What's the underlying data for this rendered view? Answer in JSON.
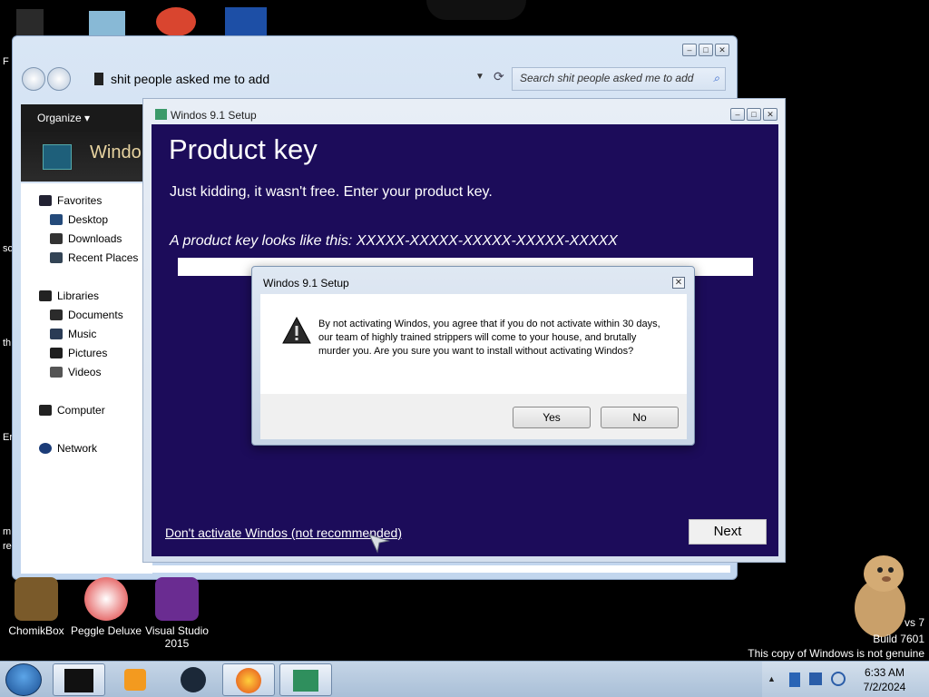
{
  "explorer": {
    "address": "shit people asked me to add",
    "search_placeholder": "Search shit people asked me to add",
    "organize": "Organize ▾",
    "banner_text": "Windo",
    "nav": {
      "favorites": "Favorites",
      "desktop": "Desktop",
      "downloads": "Downloads",
      "recent": "Recent Places",
      "libraries": "Libraries",
      "documents": "Documents",
      "music": "Music",
      "pictures": "Pictures",
      "videos": "Videos",
      "computer": "Computer",
      "network": "Network"
    }
  },
  "setup": {
    "title": "Windos 9.1 Setup",
    "heading": "Product key",
    "subtitle": "Just kidding, it wasn't free. Enter your product key.",
    "example": "A product key looks like this: XXXXX-XXXXX-XXXXX-XXXXX-XXXXX",
    "skip_link": "Don't activate Windos (not recommended)",
    "next": "Next"
  },
  "dialog": {
    "title": "Windos 9.1 Setup",
    "message": "By not activating Windos, you agree that if you do not activate within 30 days, our team of highly trained strippers will come to your house, and brutally murder you. Are you sure you want to install without activating Windos?",
    "yes": "Yes",
    "no": "No",
    "close": "✕"
  },
  "desktop_icons": {
    "chomik": "ChomikBox",
    "peggle": "Peggle Deluxe",
    "vs": "Visual Studio 2015"
  },
  "edge_fragments": [
    "F",
    "sc",
    "th",
    "Er",
    "m",
    "re"
  ],
  "watermark": {
    "line1": "vs 7",
    "line2": "Build 7601",
    "line3": "This copy of Windows is not genuine"
  },
  "clock": {
    "time": "6:33 AM",
    "date": "7/2/2024"
  },
  "colors": {
    "setup_bg": "#1c0c5a",
    "taskbar": "#b8cbe0"
  }
}
